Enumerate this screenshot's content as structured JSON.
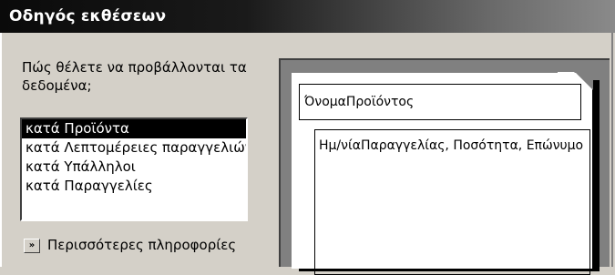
{
  "window": {
    "title": "Οδηγός εκθέσεων"
  },
  "prompt": {
    "line1": "Πώς θέλετε να προβάλλονται τα",
    "line2": "δεδομένα;"
  },
  "listbox": {
    "items": [
      {
        "label": "κατά Προϊόντα",
        "selected": true
      },
      {
        "label": "κατά Λεπτομέρειες παραγγελιών",
        "selected": false
      },
      {
        "label": "κατά Υπάλληλοι",
        "selected": false
      },
      {
        "label": "κατά Παραγγελίες",
        "selected": false
      }
    ]
  },
  "more_info": {
    "icon": "double-chevron-right-icon",
    "button_glyph": "»",
    "label": "Περισσότερες πληροφορίες"
  },
  "preview": {
    "group_field": "ΌνομαΠροϊόντος",
    "detail_fields": "Ημ/νίαΠαραγγελίας, Ποσότητα, Επώνυμο"
  }
}
